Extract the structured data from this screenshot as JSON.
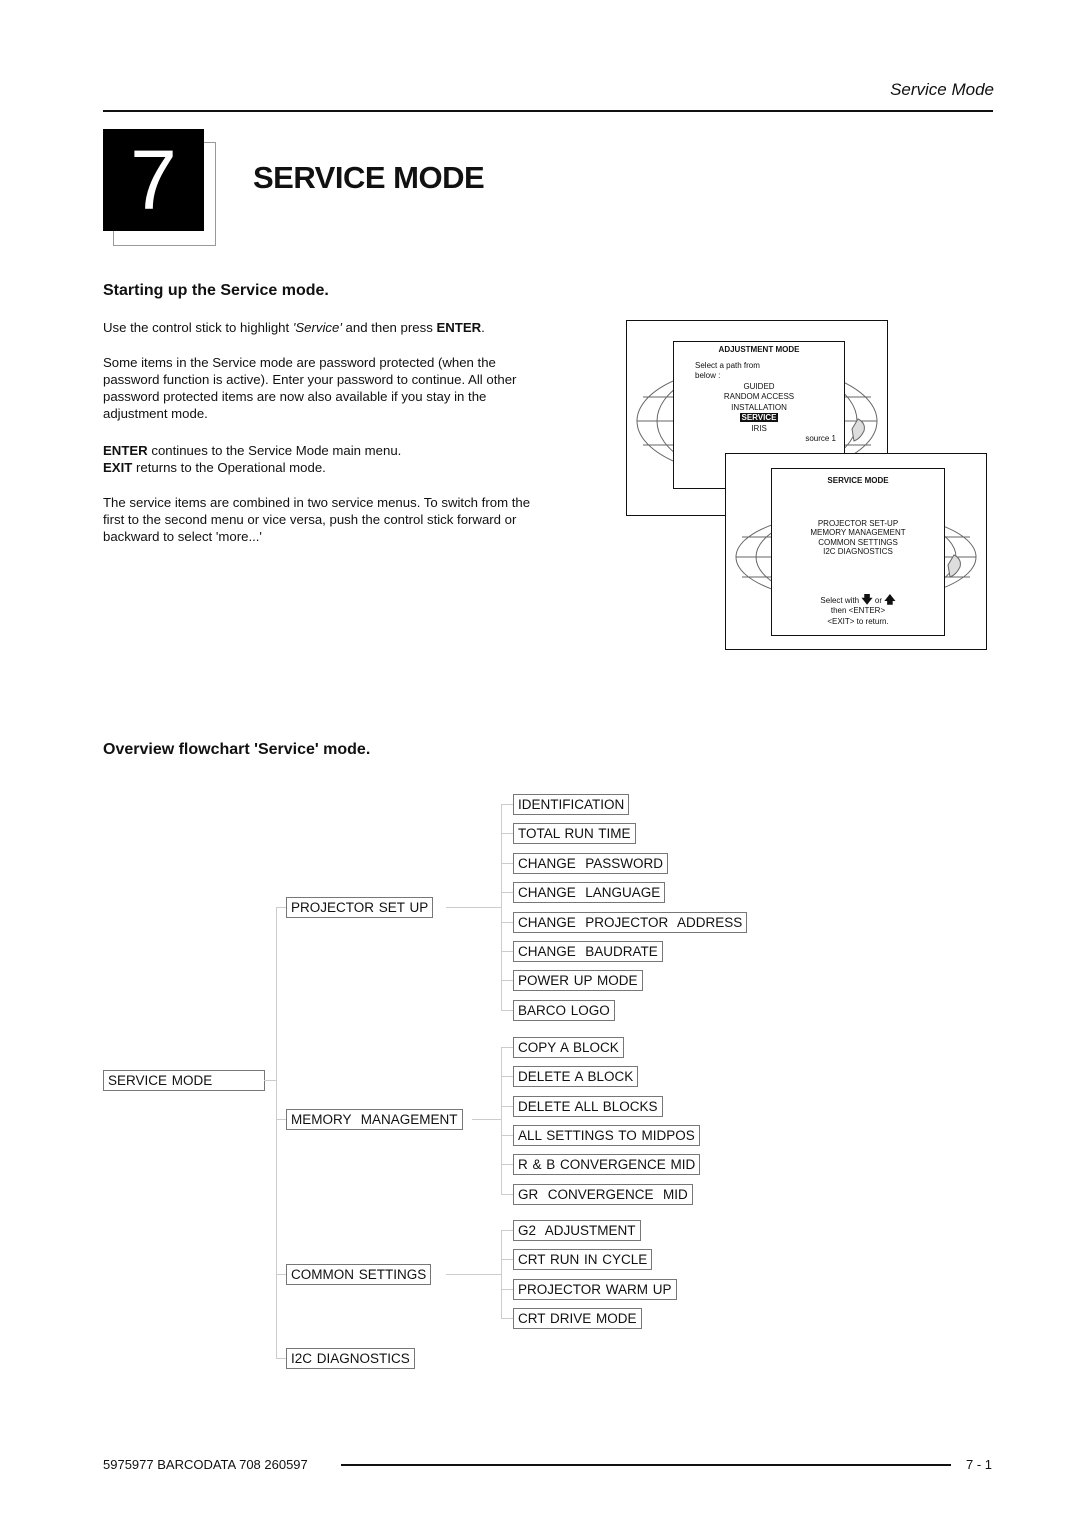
{
  "header": {
    "running_head": "Service Mode",
    "chapter_number": "7",
    "chapter_title": "SERVICE MODE"
  },
  "section1": {
    "heading": "Starting up the Service mode.",
    "p1_pre": "Use the control stick to highlight ",
    "p1_em": "'Service'",
    "p1_mid": " and then press ",
    "p1_strong": "ENTER",
    "p1_end": ".",
    "p2": "Some items in the Service mode are password protected (when the password function is active).  Enter your password to continue.  All other password protected items are now also available if you stay in the adjustment mode.",
    "p3_l1_strong": "ENTER",
    "p3_l1": " continues to the Service Mode main menu.",
    "p3_l2_strong": "EXIT",
    "p3_l2": " returns to the Operational mode.",
    "p4": "The service items are combined in two service menus.  To switch from the first to the second menu or vice versa, push the control stick forward or backward to select 'more...'"
  },
  "osd_adjustment": {
    "title": "ADJUSTMENT MODE",
    "prompt_l1": "Select a path from",
    "prompt_l2": "below :",
    "items": [
      "GUIDED",
      "RANDOM ACCESS",
      "INSTALLATION",
      "SERVICE",
      "IRIS"
    ],
    "selected_index": 3,
    "source": "source 1"
  },
  "osd_service": {
    "title": "SERVICE MODE",
    "items": [
      "PROJECTOR SET-UP",
      "MEMORY MANAGEMENT",
      "COMMON SETTINGS",
      "I2C DIAGNOSTICS"
    ],
    "hint_l1_a": "Select with",
    "hint_l1_b": "or",
    "hint_l2": "then <ENTER>",
    "hint_l3": "<EXIT> to return.",
    "icons": {
      "down": "arrow-down-icon",
      "up": "arrow-up-icon"
    }
  },
  "section2": {
    "heading": "Overview flowchart 'Service' mode."
  },
  "flowchart": {
    "root": "SERVICE MODE",
    "branches": [
      {
        "label": "PROJECTOR SET UP",
        "children": [
          "IDENTIFICATION",
          "TOTAL RUN TIME",
          "CHANGE  PASSWORD",
          "CHANGE  LANGUAGE",
          "CHANGE  PROJECTOR  ADDRESS",
          "CHANGE  BAUDRATE",
          "POWER UP MODE",
          "BARCO LOGO"
        ]
      },
      {
        "label": "MEMORY  MANAGEMENT",
        "children": [
          "COPY A BLOCK",
          "DELETE A BLOCK",
          "DELETE ALL BLOCKS",
          "ALL SETTINGS TO MIDPOS",
          "R & B CONVERGENCE MID",
          "GR  CONVERGENCE  MID"
        ]
      },
      {
        "label": "COMMON SETTINGS",
        "children": [
          "G2  ADJUSTMENT",
          "CRT RUN IN CYCLE",
          "PROJECTOR WARM UP",
          "CRT DRIVE MODE"
        ]
      },
      {
        "label": "I2C DIAGNOSTICS",
        "children": []
      }
    ]
  },
  "footer": {
    "doc_ref": "5975977 BARCODATA 708 260597",
    "page": "7 - 1"
  }
}
